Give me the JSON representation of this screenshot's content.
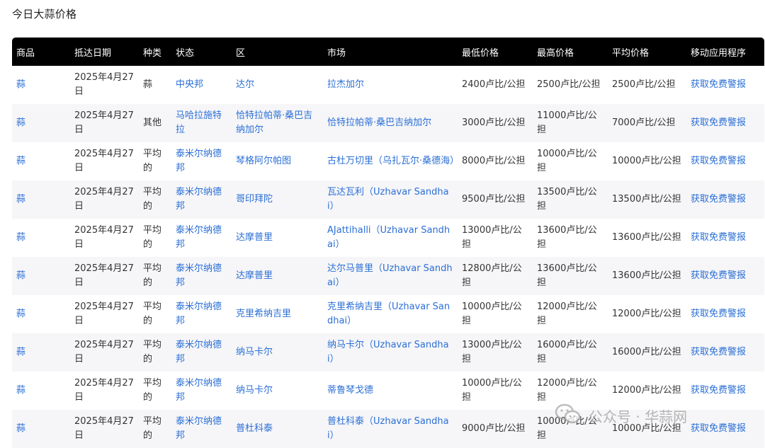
{
  "title": "今日大蒜价格",
  "table": {
    "headers": [
      "商品",
      "抵达日期",
      "种类",
      "状态",
      "区",
      "市场",
      "最低价格",
      "最高价格",
      "平均价格",
      "移动应用程序"
    ],
    "rows": [
      {
        "commodity": "蒜",
        "date": "2025年4月27日",
        "variety": "蒜",
        "state": "中央邦",
        "district": "达尔",
        "market": "拉杰加尔",
        "min": "2400卢比/公担",
        "max": "2500卢比/公担",
        "avg": "2500卢比/公担",
        "app": "获取免费警报"
      },
      {
        "commodity": "蒜",
        "date": "2025年4月27日",
        "variety": "其他",
        "state": "马哈拉施特拉",
        "district": "恰特拉帕蒂·桑巴吉纳加尔",
        "market": "恰特拉帕蒂·桑巴吉纳加尔",
        "min": "3000卢比/公担",
        "max": "11000卢比/公担",
        "avg": "7000卢比/公担",
        "app": "获取免费警报"
      },
      {
        "commodity": "蒜",
        "date": "2025年4月27日",
        "variety": "平均的",
        "state": "泰米尔纳德邦",
        "district": "琴格阿尔帕图",
        "market": "古杜万切里（乌扎瓦尔·桑德海）",
        "min": "8000卢比/公担",
        "max": "10000卢比/公担",
        "avg": "10000卢比/公担",
        "app": "获取免费警报"
      },
      {
        "commodity": "蒜",
        "date": "2025年4月27日",
        "variety": "平均的",
        "state": "泰米尔纳德邦",
        "district": "哥印拜陀",
        "market": "瓦达瓦利（Uzhavar Sandhai）",
        "min": "9500卢比/公担",
        "max": "13500卢比/公担",
        "avg": "13500卢比/公担",
        "app": "获取免费警报"
      },
      {
        "commodity": "蒜",
        "date": "2025年4月27日",
        "variety": "平均的",
        "state": "泰米尔纳德邦",
        "district": "达摩普里",
        "market": "AJattihalli（Uzhavar Sandhai）",
        "min": "13000卢比/公担",
        "max": "13600卢比/公担",
        "avg": "13600卢比/公担",
        "app": "获取免费警报"
      },
      {
        "commodity": "蒜",
        "date": "2025年4月27日",
        "variety": "平均的",
        "state": "泰米尔纳德邦",
        "district": "达摩普里",
        "market": "达尔马普里（Uzhavar Sandhai）",
        "min": "12800卢比/公担",
        "max": "13600卢比/公担",
        "avg": "13600卢比/公担",
        "app": "获取免费警报"
      },
      {
        "commodity": "蒜",
        "date": "2025年4月27日",
        "variety": "平均的",
        "state": "泰米尔纳德邦",
        "district": "克里希纳吉里",
        "market": "克里希纳吉里（Uzhavar Sandhai）",
        "min": "10000卢比/公担",
        "max": "12000卢比/公担",
        "avg": "12000卢比/公担",
        "app": "获取免费警报"
      },
      {
        "commodity": "蒜",
        "date": "2025年4月27日",
        "variety": "平均的",
        "state": "泰米尔纳德邦",
        "district": "纳马卡尔",
        "market": "纳马卡尔（Uzhavar Sandhai）",
        "min": "13000卢比/公担",
        "max": "16000卢比/公担",
        "avg": "16000卢比/公担",
        "app": "获取免费警报"
      },
      {
        "commodity": "蒜",
        "date": "2025年4月27日",
        "variety": "平均的",
        "state": "泰米尔纳德邦",
        "district": "纳马卡尔",
        "market": "蒂鲁琴戈德",
        "min": "10000卢比/公担",
        "max": "12000卢比/公担",
        "avg": "12000卢比/公担",
        "app": "获取免费警报"
      },
      {
        "commodity": "蒜",
        "date": "2025年4月27日",
        "variety": "平均的",
        "state": "泰米尔纳德邦",
        "district": "普杜科泰",
        "market": "普杜科泰（Uzhavar Sandhai）",
        "min": "9000卢比/公担",
        "max": "10000卢比/公担",
        "avg": "10000卢比/公担",
        "app": "获取免费警报"
      }
    ]
  },
  "watermark": {
    "text": "公众号 · 华蒜网",
    "icon": "wechat-icon"
  }
}
